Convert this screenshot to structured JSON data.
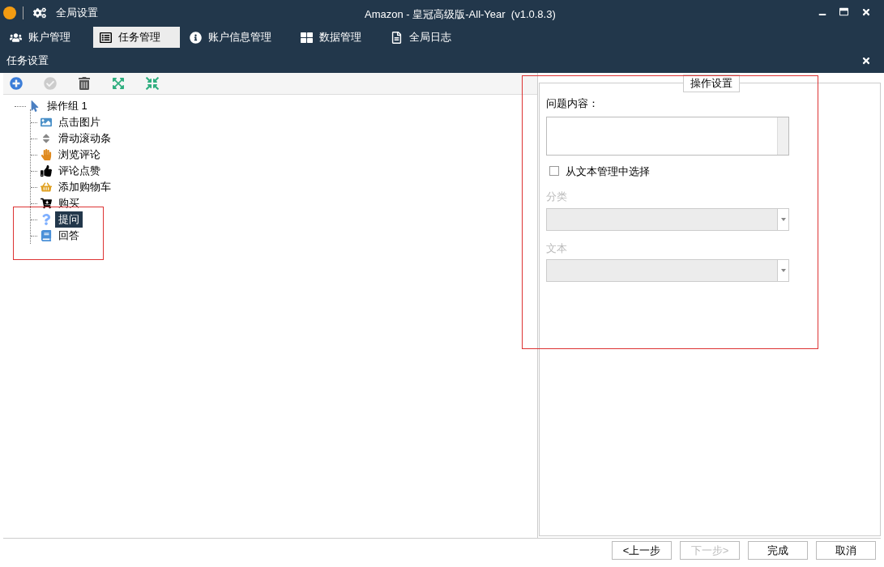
{
  "window": {
    "settings_label": "全局设置",
    "title": "Amazon - 皇冠高级版-All-Year  (v1.0.8.3)"
  },
  "tabs": [
    {
      "label": "账户管理",
      "kind": "users",
      "selected": false
    },
    {
      "label": "任务管理",
      "kind": "list",
      "selected": true
    },
    {
      "label": "账户信息管理",
      "kind": "info",
      "selected": false
    },
    {
      "label": "数据管理",
      "kind": "grid",
      "selected": false
    },
    {
      "label": "全局日志",
      "kind": "doc",
      "selected": false
    }
  ],
  "subheader": {
    "title": "任务设置"
  },
  "toolbar": [
    {
      "kind": "add",
      "disabled": false
    },
    {
      "kind": "check",
      "disabled": true
    },
    {
      "kind": "delete",
      "disabled": false
    },
    {
      "kind": "expand",
      "disabled": false
    },
    {
      "kind": "collapse",
      "disabled": false
    }
  ],
  "tree": [
    {
      "label": "操作组 1",
      "kind": "group",
      "selected": false,
      "children": [
        {
          "label": "点击图片",
          "kind": "image",
          "selected": false
        },
        {
          "label": "滑动滚动条",
          "kind": "scroll",
          "selected": false
        },
        {
          "label": "浏览评论",
          "kind": "browse",
          "selected": false
        },
        {
          "label": "评论点赞",
          "kind": "like",
          "selected": false
        },
        {
          "label": "添加购物车",
          "kind": "cart",
          "selected": false
        },
        {
          "label": "购买",
          "kind": "buy",
          "selected": false
        },
        {
          "label": "提问",
          "kind": "question",
          "selected": true
        },
        {
          "label": "回答",
          "kind": "answer",
          "selected": false
        }
      ]
    }
  ],
  "settings_panel": {
    "title": "操作设置",
    "question_label": "问题内容：",
    "from_text_checkbox": {
      "label": "从文本管理中选择",
      "checked": false
    },
    "fields": [
      {
        "label": "分类",
        "disabled": true
      },
      {
        "label": "文本",
        "disabled": true
      }
    ]
  },
  "footer_buttons": [
    {
      "label": "<上一步",
      "disabled": false
    },
    {
      "label": "下一步>",
      "disabled": true
    },
    {
      "label": "完成",
      "disabled": false
    },
    {
      "label": "取消",
      "disabled": false
    }
  ]
}
